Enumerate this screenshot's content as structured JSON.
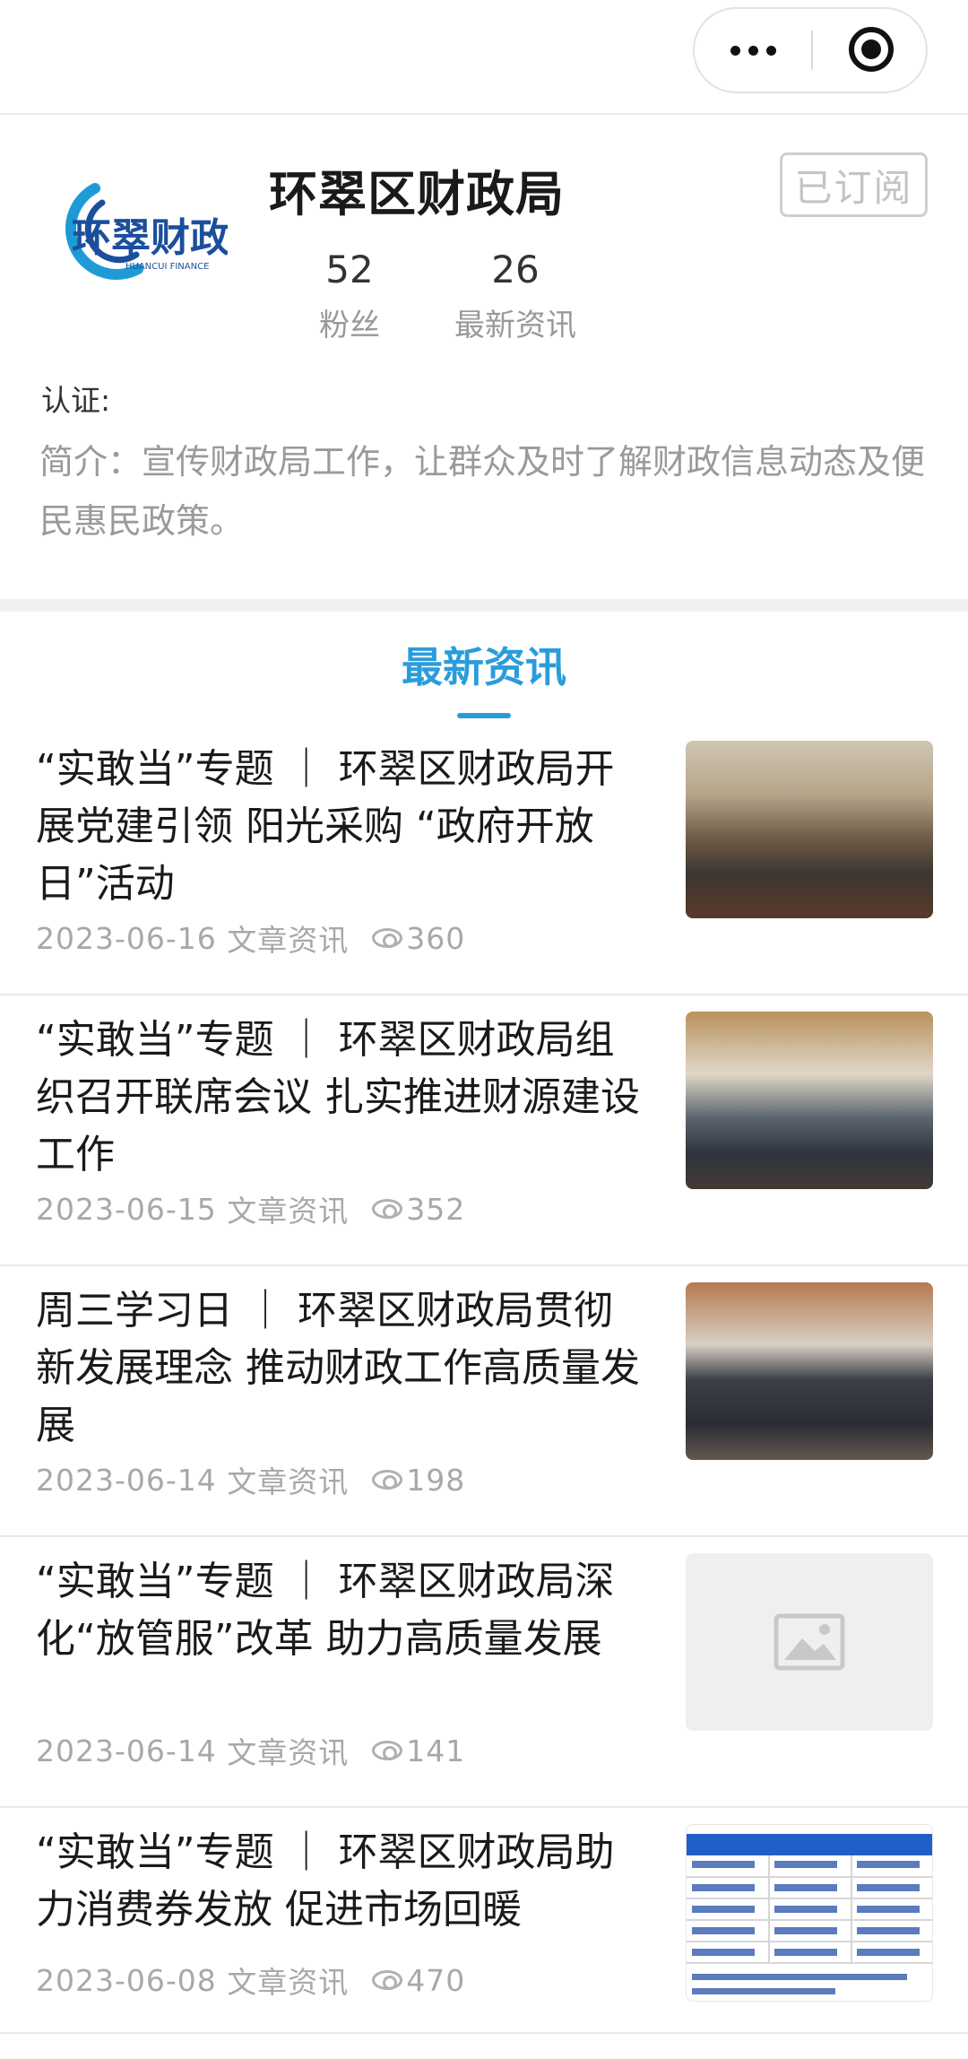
{
  "org": {
    "name": "环翠区财政局",
    "logo_text": "环翠财政",
    "logo_sub": "HUANCUI FINANCE",
    "subscribe_label": "已订阅",
    "stats": [
      {
        "num": "52",
        "label": "粉丝"
      },
      {
        "num": "26",
        "label": "最新资讯"
      }
    ],
    "cert_label": "认证:",
    "intro": "简介：宣传财政局工作，让群众及时了解财政信息动态及便民惠民政策。"
  },
  "section_title": "最新资讯",
  "news": [
    {
      "title": "“实敢当”专题 ｜ 环翠区财政局开展党建引领 阳光采购 “政府开放日”活动",
      "date": "2023-06-16",
      "category": "文章资讯",
      "views": "360",
      "thumb": "photo-meeting"
    },
    {
      "title": "“实敢当”专题 ｜ 环翠区财政局组织召开联席会议 扎实推进财源建设工作",
      "date": "2023-06-15",
      "category": "文章资讯",
      "views": "352",
      "thumb": "photo-conference"
    },
    {
      "title": "周三学习日 ｜ 环翠区财政局贯彻新发展理念 推动财政工作高质量发展",
      "date": "2023-06-14",
      "category": "文章资讯",
      "views": "198",
      "thumb": "photo-study"
    },
    {
      "title": "“实敢当”专题 ｜ 环翠区财政局深化“放管服”改革 助力高质量发展",
      "date": "2023-06-14",
      "category": "文章资讯",
      "views": "141",
      "thumb": "image-placeholder-icon"
    },
    {
      "title": "“实敢当”专题 ｜ 环翠区财政局助力消费券发放 促进市场回暖",
      "date": "2023-06-08",
      "category": "文章资讯",
      "views": "470",
      "thumb": "document-table"
    }
  ],
  "colors": {
    "accent": "#2a9cdc",
    "muted": "#9a9a9a"
  }
}
